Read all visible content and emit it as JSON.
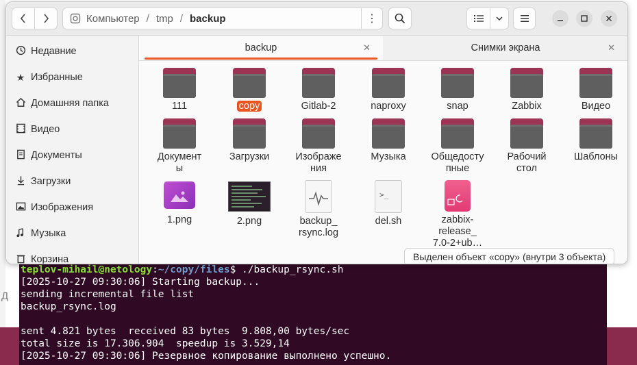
{
  "background": {
    "left_text": "Д",
    "colors": {
      "desktop_maroon": "#8a2a4d",
      "terminal_bg": "#300a24",
      "accent": "#e95420",
      "folder_tab": "#9c3555"
    }
  },
  "terminal": {
    "prompt_user": "teplov-mihail@netology",
    "prompt_sep": ":",
    "prompt_path": "~/copy/files",
    "prompt_cmd": "$ ./backup_rsync.sh",
    "lines": [
      "[2025-10-27 09:30:06] Starting backup...",
      "sending incremental file list",
      "backup_rsync.log",
      "",
      "sent 4.821 bytes  received 83 bytes  9.808,00 bytes/sec",
      "total size is 17.306.904  speedup is 3.529,14",
      "[2025-10-27 09:30:06] Резервное копирование выполнено успешно."
    ]
  },
  "headerbar": {
    "back_icon": "chevron-left-icon",
    "forward_icon": "chevron-right-icon",
    "path": {
      "root": "Компьютер",
      "seg1": "tmp",
      "current": "backup"
    },
    "path_menu_icon": "vertical-ellipsis-icon",
    "search_icon": "search-icon",
    "view_icon": "list-view-icon",
    "view_dropdown_icon": "chevron-down-icon",
    "menu_icon": "hamburger-icon"
  },
  "sidebar": {
    "items": [
      {
        "label": "Недавние",
        "icon": "clock-icon"
      },
      {
        "label": "Избранные",
        "icon": "star-icon"
      },
      {
        "label": "Домашняя папка",
        "icon": "home-icon"
      },
      {
        "label": "Видео",
        "icon": "film-icon"
      },
      {
        "label": "Документы",
        "icon": "document-icon"
      },
      {
        "label": "Загрузки",
        "icon": "download-icon"
      },
      {
        "label": "Изображения",
        "icon": "image-icon"
      },
      {
        "label": "Музыка",
        "icon": "music-icon"
      },
      {
        "label": "Корзина",
        "icon": "trash-icon"
      }
    ]
  },
  "tabs": [
    {
      "label": "backup",
      "active": true
    },
    {
      "label": "Снимки экрана",
      "active": false
    }
  ],
  "files": {
    "row1": [
      "111",
      "copy",
      "Gitlab-2",
      "naproxy",
      "snap",
      "Zabbix",
      "Видео"
    ],
    "row2": [
      {
        "line1": "Докумeнт",
        "line2": "ы"
      },
      {
        "line1": "Загрузки",
        "line2": ""
      },
      {
        "line1": "Изображе",
        "line2": "ния"
      },
      {
        "line1": "Музыка",
        "line2": ""
      },
      {
        "line1": "Общедосту",
        "line2": "пные"
      },
      {
        "line1": "Рабочий",
        "line2": "стол"
      },
      {
        "line1": "Шаблоны",
        "line2": ""
      }
    ],
    "row3": [
      {
        "line1": "1.png",
        "line2": "",
        "line3": ""
      },
      {
        "line1": "2.png",
        "line2": "",
        "line3": ""
      },
      {
        "line1": "backup_",
        "line2": "rsync.log",
        "line3": ""
      },
      {
        "line1": "del.sh",
        "line2": "",
        "line3": ""
      },
      {
        "line1": "zabbix-",
        "line2": "release_",
        "line3": "7.0-2+ub…"
      }
    ],
    "selected": "copy"
  },
  "status": "Выделен объект «copy» (внутри 3 объекта)"
}
